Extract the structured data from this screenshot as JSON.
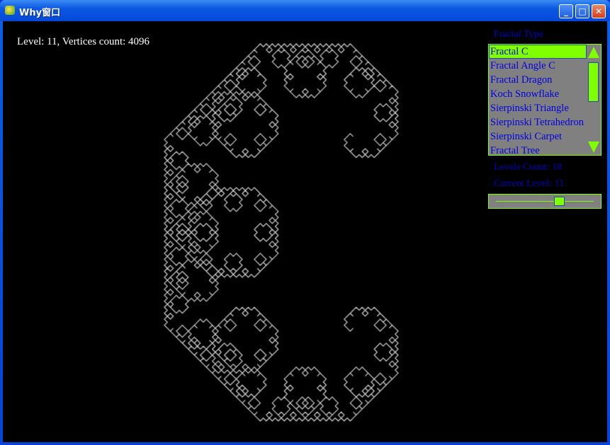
{
  "window": {
    "title": "Why窗口",
    "minimize": "_",
    "maximize": "□",
    "close": "✕"
  },
  "canvas": {
    "info": "Level: 11, Vertices count: 4096",
    "fractal": "Lévy C curve",
    "level": 11,
    "line_color": "#d0d0d0"
  },
  "panel": {
    "fractal_type_label": "Fractal Type",
    "fractal_types": [
      "Fractal C",
      "Fractal Angle C",
      "Fractal Dragon",
      "Koch Snowflake",
      "Sierpinski Triangle",
      "Sierpinski Tetrahedron",
      "Sierpinski Carpet",
      "Fractal Tree"
    ],
    "selected": "Fractal C",
    "levels_count": "Levels Count: 18",
    "current_level": "Current Level: 11",
    "slider_value": 11,
    "slider_max": 18,
    "accent": "#80ff00",
    "text_color": "#0000ff"
  }
}
